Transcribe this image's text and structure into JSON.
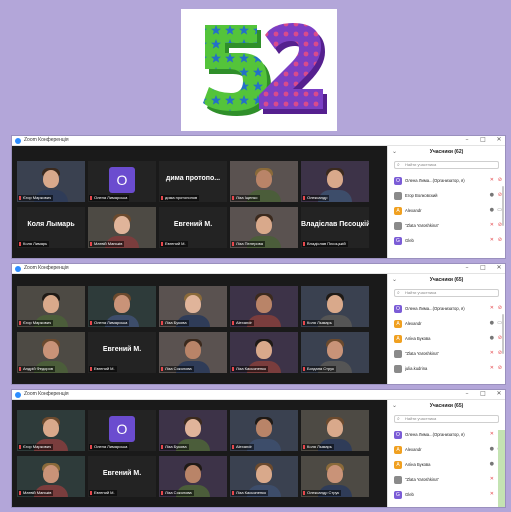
{
  "header": {
    "number_text": "52"
  },
  "windows": [
    {
      "title": "Zoom Конференція",
      "controls": [
        "–",
        "□",
        "✕"
      ],
      "panel_title": "Учасники (62)",
      "search_placeholder": "Найти участника",
      "tiles": [
        {
          "label": "Єгор Маркович",
          "big": "",
          "letter": ""
        },
        {
          "label": "Олена Лимарська",
          "big": "",
          "letter": "O"
        },
        {
          "label": "дима протопопов",
          "big": "дима протопо...",
          "letter": ""
        },
        {
          "label": "Ліза Іщенко",
          "big": "",
          "letter": ""
        },
        {
          "label": "Олександр",
          "big": "",
          "letter": "",
          "active": true
        },
        {
          "label": "Коля Лимарь",
          "big": "Коля Лымарь",
          "letter": ""
        },
        {
          "label": "Матвій Маньків",
          "big": "",
          "letter": ""
        },
        {
          "label": "Евгений М.",
          "big": "Евгений М.",
          "letter": ""
        },
        {
          "label": "Ліза Пелерова",
          "big": "",
          "letter": ""
        },
        {
          "label": "Владіслав Пєсоцькій",
          "big": "Владіслав Пєсоцкій",
          "letter": ""
        }
      ],
      "participants": [
        {
          "initial": "O",
          "name": "Олена Лима...(Организатор, я)",
          "color": "#7b5cd6",
          "mic": "off",
          "cam": "off"
        },
        {
          "initial": "",
          "name": "Егор Волковский",
          "color": "#8a8a8a",
          "mic": "on",
          "cam": "off"
        },
        {
          "initial": "A",
          "name": "Alexandr",
          "color": "#f0a020",
          "mic": "on",
          "cam": "on"
        },
        {
          "initial": "",
          "name": "\"Zlata Yaroshkina\"",
          "color": "#8a8a8a",
          "mic": "off",
          "cam": "off"
        },
        {
          "initial": "G",
          "name": "Gleb",
          "color": "#7b5cd6",
          "mic": "off",
          "cam": "off"
        }
      ]
    },
    {
      "title": "Zoom Конференція",
      "controls": [
        "–",
        "□",
        "✕"
      ],
      "panel_title": "Учасники (65)",
      "search_placeholder": "Найти участника",
      "tiles": [
        {
          "label": "Єгор Маркович",
          "big": "",
          "letter": ""
        },
        {
          "label": "Олена Лимарська",
          "big": "",
          "letter": ""
        },
        {
          "label": "Ліза Букова",
          "big": "",
          "letter": ""
        },
        {
          "label": "Alexandr",
          "big": "",
          "letter": "",
          "active": true
        },
        {
          "label": "Коля Лымарь",
          "big": "",
          "letter": ""
        },
        {
          "label": "Андрій Федоров",
          "big": "",
          "letter": ""
        },
        {
          "label": "Евгений М.",
          "big": "Евгений М.",
          "letter": ""
        },
        {
          "label": "Ліза Соколова",
          "big": "",
          "letter": ""
        },
        {
          "label": "Ліза Касьяненко",
          "big": "",
          "letter": ""
        },
        {
          "label": "Богдана Струк",
          "big": "",
          "letter": ""
        }
      ],
      "participants": [
        {
          "initial": "O",
          "name": "Олена Лима...(Организатор, я)",
          "color": "#7b5cd6",
          "mic": "off",
          "cam": "off"
        },
        {
          "initial": "A",
          "name": "Alexandr",
          "color": "#f0a020",
          "mic": "on",
          "cam": "on"
        },
        {
          "initial": "A",
          "name": "Аліна Букова",
          "color": "#f0a020",
          "mic": "on",
          "cam": "off"
        },
        {
          "initial": "",
          "name": "\"Zlata Yaroshkina\"",
          "color": "#8a8a8a",
          "mic": "off",
          "cam": "off"
        },
        {
          "initial": "",
          "name": "julia.kudrina",
          "color": "#8a8a8a",
          "mic": "off",
          "cam": "off"
        }
      ]
    },
    {
      "title": "Zoom Конференція",
      "controls": [
        "–",
        "□",
        "✕"
      ],
      "panel_title": "Учасники (65)",
      "search_placeholder": "Найти участника",
      "tiles": [
        {
          "label": "Єгор Маркович",
          "big": "",
          "letter": ""
        },
        {
          "label": "Олена Лимарська",
          "big": "",
          "letter": "O"
        },
        {
          "label": "Ліза Букова",
          "big": "",
          "letter": ""
        },
        {
          "label": "Alexandr",
          "big": "",
          "letter": "",
          "active": true
        },
        {
          "label": "Коля Лымарь",
          "big": "",
          "letter": ""
        },
        {
          "label": "Матвій Маньків",
          "big": "",
          "letter": ""
        },
        {
          "label": "Евгений М.",
          "big": "Евгений М.",
          "letter": ""
        },
        {
          "label": "Ліза Соколова",
          "big": "",
          "letter": ""
        },
        {
          "label": "Ліза Касьяненко",
          "big": "",
          "letter": ""
        },
        {
          "label": "Олександр Струк",
          "big": "",
          "letter": ""
        }
      ],
      "participants": [
        {
          "initial": "O",
          "name": "Олена Лима...(Организатор, я)",
          "color": "#7b5cd6",
          "mic": "off",
          "cam": "off"
        },
        {
          "initial": "A",
          "name": "Alexandr",
          "color": "#f0a020",
          "mic": "on",
          "cam": "on"
        },
        {
          "initial": "A",
          "name": "Аліна Букова",
          "color": "#f0a020",
          "mic": "on",
          "cam": "off"
        },
        {
          "initial": "",
          "name": "\"Zlata Yaroshkina\"",
          "color": "#8a8a8a",
          "mic": "off",
          "cam": "off"
        },
        {
          "initial": "G",
          "name": "Gleb",
          "color": "#7b5cd6",
          "mic": "off",
          "cam": "off"
        }
      ]
    }
  ],
  "icons": {
    "mic_off": "mic-off-icon",
    "cam_off": "camera-off-icon",
    "search": "search-icon"
  },
  "colors": {
    "background": "#b3a6d9",
    "gallery": "#1a1a1a",
    "active_border": "#c3e14c",
    "mute_red": "#e5484d",
    "five_green": "#54c43a",
    "five_stars": "#2470c8",
    "two_purple": "#7b3fc4",
    "two_dots": "#d94b8c"
  }
}
